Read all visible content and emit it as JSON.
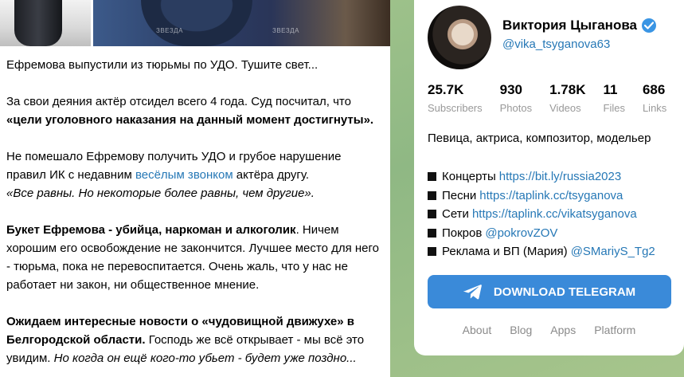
{
  "post": {
    "watermark": "ЗВЕЗДА",
    "paragraphs": [
      [
        {
          "t": "Ефремова выпустили из тюрьмы по УДО. Тушите свет...",
          "s": "plain"
        }
      ],
      [
        {
          "t": "За свои деяния актёр отсидел всего 4 года. Суд посчитал, что ",
          "s": "plain"
        },
        {
          "t": "«цели уголовного наказания на данный момент достигнуты».",
          "s": "bold"
        }
      ],
      [
        {
          "t": "Не помешало Ефремову получить УДО и грубое нарушение правил ИК с недавним ",
          "s": "plain"
        },
        {
          "t": "весёлым звонком",
          "s": "link"
        },
        {
          "t": " актёра другу.",
          "s": "plain"
        },
        {
          "t": "br",
          "s": "br"
        },
        {
          "t": "«Все равны. Но некоторые более равны, чем другие».",
          "s": "italic"
        }
      ],
      [
        {
          "t": "Букет Ефремова - убийца, наркоман и алкоголик",
          "s": "bold"
        },
        {
          "t": ". Ничем хорошим его освобождение не закончится. Лучшее место для него - тюрьма, пока не перевоспитается. Очень жаль, что у нас не работает ни закон, ни общественное мнение.",
          "s": "plain"
        }
      ],
      [
        {
          "t": "Ожидаем интересные новости о «чудовищной движухе» в Белгородской области.",
          "s": "bold"
        },
        {
          "t": " Господь же всё открывает - мы всё это увидим. ",
          "s": "plain"
        },
        {
          "t": "Но когда он ещё кого-то убьет - будет уже поздно...",
          "s": "italic"
        }
      ]
    ]
  },
  "channel": {
    "name": "Виктория Цыганова",
    "username": "@vika_tsyganova63",
    "stats": [
      {
        "value": "25.7K",
        "label": "Subscribers"
      },
      {
        "value": "930",
        "label": "Photos"
      },
      {
        "value": "1.78K",
        "label": "Videos"
      },
      {
        "value": "11",
        "label": "Files"
      },
      {
        "value": "686",
        "label": "Links"
      }
    ],
    "bio": "Певица, актриса, композитор, модельер",
    "links": [
      {
        "label": "Концерты",
        "url": "https://bit.ly/russia2023"
      },
      {
        "label": "Песни",
        "url": "https://taplink.cc/tsyganova"
      },
      {
        "label": "Сети",
        "url": "https://taplink.cc/vikatsyganova"
      },
      {
        "label": "Покров",
        "url": "@pokrovZOV"
      },
      {
        "label": "Реклама и ВП (Мария)",
        "url": "@SMariyS_Tg2"
      }
    ],
    "download_label": "DOWNLOAD TELEGRAM",
    "footer": [
      "About",
      "Blog",
      "Apps",
      "Platform"
    ],
    "accent_color": "#3a8ad9",
    "link_color": "#2678b6"
  }
}
